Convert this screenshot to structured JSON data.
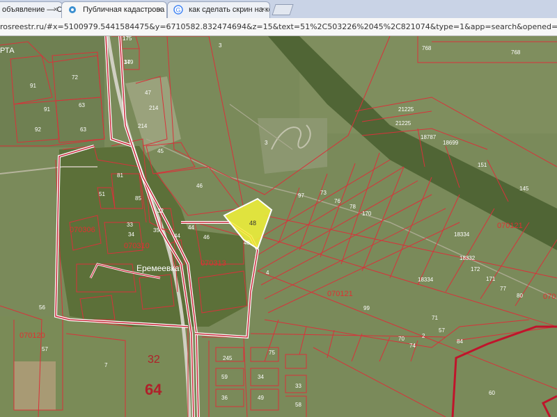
{
  "browser": {
    "tabs": [
      {
        "label": "объявление — С"
      },
      {
        "label": "Публичная кадастрова"
      },
      {
        "label": "как сделать скрин на ко"
      }
    ],
    "close_glyph": "×",
    "url": "rosreestr.ru/#x=5100979.5441584475&y=6710582.832474694&z=15&text=51%2C503226%2045%2C821074&type=1&app=search&opened=0"
  },
  "map": {
    "colors": {
      "parcel_line": "#d8323a",
      "boundary": "#c0142b",
      "selected_fill": "#f2f23a",
      "vegetation": "#647a43"
    },
    "labels": {
      "area_top_left": "РТА",
      "village": "Еремеевка",
      "quarters": [
        "070306",
        "070310",
        "070313",
        "070121",
        "070121",
        "070120",
        "070121"
      ],
      "big_32": "32",
      "big_64": "64",
      "parcels": [
        "175",
        "179",
        "3",
        "47",
        "214",
        "214",
        "91",
        "72",
        "91",
        "63",
        "92",
        "63",
        "768",
        "768",
        "21225",
        "21225",
        "18699",
        "18787",
        "151",
        "145",
        "45",
        "3",
        "81",
        "46",
        "51",
        "85",
        "32",
        "33",
        "34",
        "35",
        "44",
        "44",
        "46",
        "97",
        "73",
        "76",
        "78",
        "170",
        "48",
        "4",
        "18334",
        "18332",
        "172",
        "171",
        "77",
        "80",
        "18334",
        "99",
        "84",
        "57",
        "71",
        "2",
        "74",
        "70",
        "60",
        "7",
        "245",
        "75",
        "59",
        "34",
        "36",
        "49",
        "33",
        "58",
        "57",
        "56",
        "17",
        "34"
      ]
    },
    "selected_parcel_label": "48"
  }
}
